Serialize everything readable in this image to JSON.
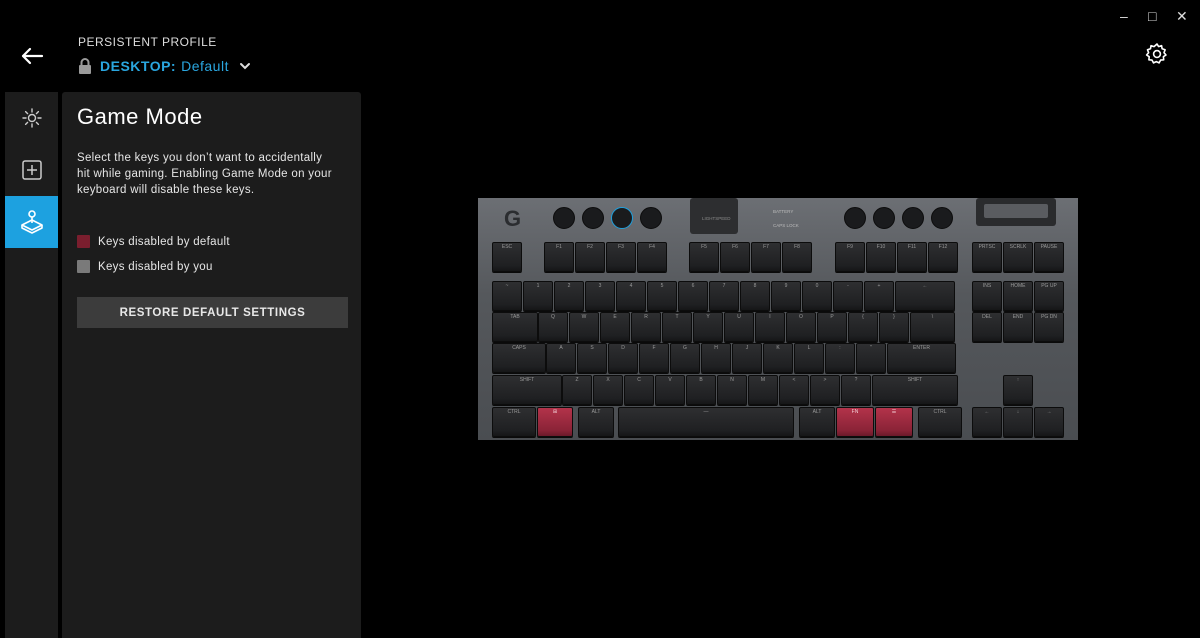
{
  "window_controls": {
    "minimize": "–",
    "maximize": "□",
    "close": "✕"
  },
  "header": {
    "profile_label": "PERSISTENT PROFILE",
    "profile_type": "DESKTOP:",
    "profile_name": "Default",
    "icons": [
      "back-arrow-icon",
      "lock-icon",
      "chevron-down-icon",
      "gear-icon"
    ]
  },
  "rail": {
    "items": [
      {
        "name": "lighting",
        "icon": "lightbulb-icon",
        "active": false
      },
      {
        "name": "assignments",
        "icon": "plus-square-icon",
        "active": false
      },
      {
        "name": "game-mode",
        "icon": "joystick-icon",
        "active": true
      }
    ]
  },
  "panel": {
    "title": "Game Mode",
    "description": "Select the keys you don’t want to accidentally hit while gaming. Enabling Game Mode on your keyboard will disable these keys.",
    "legend": [
      {
        "label": "Keys disabled by default",
        "color": "#7a1e2e"
      },
      {
        "label": "Keys disabled by you",
        "color": "#7a7a7a"
      }
    ],
    "restore_label": "RESTORE DEFAULT SETTINGS"
  },
  "keyboard": {
    "indicators": [
      "BATTERY",
      "CAPS LOCK"
    ],
    "lightspeed": "LIGHTSPEED",
    "disabled_keys": [
      "Windows",
      "FN",
      "Menu"
    ],
    "accent": "#1da1e0",
    "disabled_color": "#a52b42",
    "rows": [
      [
        "ESC",
        "F1",
        "F2",
        "F3",
        "F4",
        "F5",
        "F6",
        "F7",
        "F8",
        "F9",
        "F10",
        "F11",
        "F12",
        "PRTSC",
        "SCRLK",
        "PAUSE"
      ],
      [
        "~",
        "1",
        "2",
        "3",
        "4",
        "5",
        "6",
        "7",
        "8",
        "9",
        "0",
        "-",
        "+",
        "←",
        "INS",
        "HOME",
        "PG UP"
      ],
      [
        "TAB",
        "Q",
        "W",
        "E",
        "R",
        "T",
        "Y",
        "U",
        "I",
        "O",
        "P",
        "{",
        "}",
        "\\",
        "DEL",
        "END",
        "PG DN"
      ],
      [
        "CAPS",
        "A",
        "S",
        "D",
        "F",
        "G",
        "H",
        "J",
        "K",
        "L",
        ":",
        "\"",
        "ENTER"
      ],
      [
        "SHIFT",
        "Z",
        "X",
        "C",
        "V",
        "B",
        "N",
        "M",
        "<",
        ">",
        "?",
        "SHIFT",
        "↑"
      ],
      [
        "CTRL",
        "⊞",
        "ALT",
        "—",
        "ALT",
        "FN",
        "☰",
        "CTRL",
        "←",
        "↓",
        "→"
      ]
    ]
  }
}
